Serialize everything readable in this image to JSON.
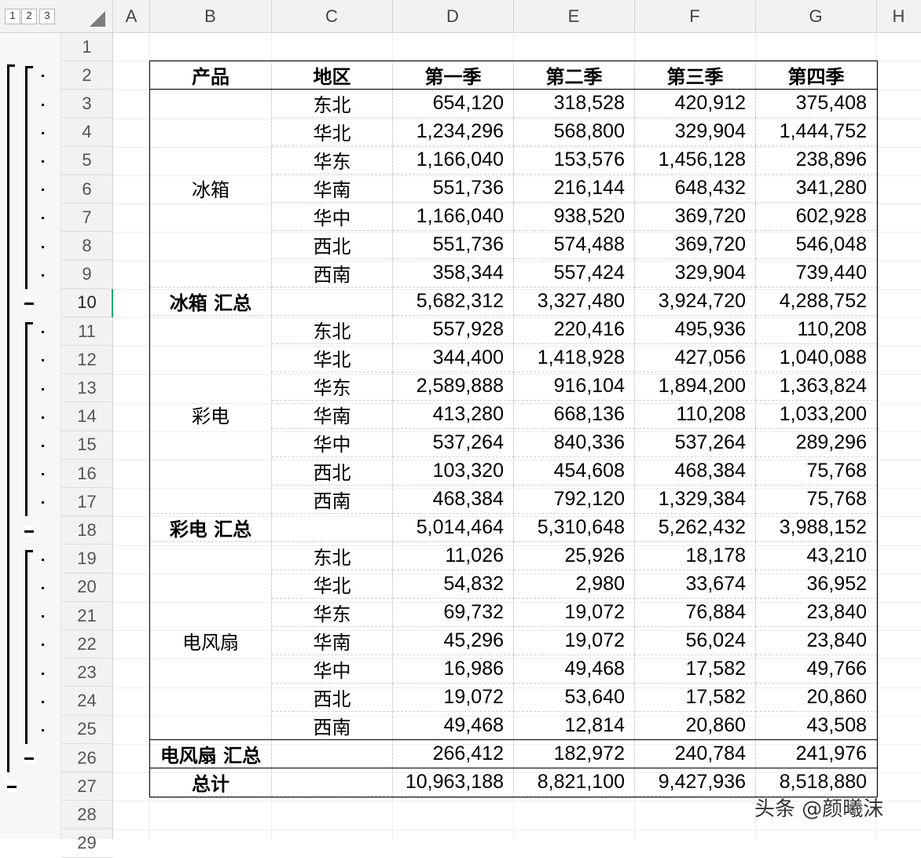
{
  "outline_levels": [
    "1",
    "2",
    "3"
  ],
  "columns": [
    "A",
    "B",
    "C",
    "D",
    "E",
    "F",
    "G",
    "H"
  ],
  "rows": [
    "1",
    "2",
    "3",
    "4",
    "5",
    "6",
    "7",
    "8",
    "9",
    "10",
    "11",
    "12",
    "13",
    "14",
    "15",
    "16",
    "17",
    "18",
    "19",
    "20",
    "21",
    "22",
    "23",
    "24",
    "25",
    "26",
    "27",
    "28",
    "29"
  ],
  "selected_row": "10",
  "table": {
    "headers": [
      "产品",
      "地区",
      "第一季",
      "第二季",
      "第三季",
      "第四季"
    ],
    "groups": [
      {
        "product": "冰箱",
        "subtotal_label": "冰箱 汇总",
        "rows": [
          {
            "region": "东北",
            "q": [
              "654,120",
              "318,528",
              "420,912",
              "375,408"
            ]
          },
          {
            "region": "华北",
            "q": [
              "1,234,296",
              "568,800",
              "329,904",
              "1,444,752"
            ]
          },
          {
            "region": "华东",
            "q": [
              "1,166,040",
              "153,576",
              "1,456,128",
              "238,896"
            ]
          },
          {
            "region": "华南",
            "q": [
              "551,736",
              "216,144",
              "648,432",
              "341,280"
            ]
          },
          {
            "region": "华中",
            "q": [
              "1,166,040",
              "938,520",
              "369,720",
              "602,928"
            ]
          },
          {
            "region": "西北",
            "q": [
              "551,736",
              "574,488",
              "369,720",
              "546,048"
            ]
          },
          {
            "region": "西南",
            "q": [
              "358,344",
              "557,424",
              "329,904",
              "739,440"
            ]
          }
        ],
        "subtotal": [
          "5,682,312",
          "3,327,480",
          "3,924,720",
          "4,288,752"
        ]
      },
      {
        "product": "彩电",
        "subtotal_label": "彩电 汇总",
        "rows": [
          {
            "region": "东北",
            "q": [
              "557,928",
              "220,416",
              "495,936",
              "110,208"
            ]
          },
          {
            "region": "华北",
            "q": [
              "344,400",
              "1,418,928",
              "427,056",
              "1,040,088"
            ]
          },
          {
            "region": "华东",
            "q": [
              "2,589,888",
              "916,104",
              "1,894,200",
              "1,363,824"
            ]
          },
          {
            "region": "华南",
            "q": [
              "413,280",
              "668,136",
              "110,208",
              "1,033,200"
            ]
          },
          {
            "region": "华中",
            "q": [
              "537,264",
              "840,336",
              "537,264",
              "289,296"
            ]
          },
          {
            "region": "西北",
            "q": [
              "103,320",
              "454,608",
              "468,384",
              "75,768"
            ]
          },
          {
            "region": "西南",
            "q": [
              "468,384",
              "792,120",
              "1,329,384",
              "75,768"
            ]
          }
        ],
        "subtotal": [
          "5,014,464",
          "5,310,648",
          "5,262,432",
          "3,988,152"
        ]
      },
      {
        "product": "电风扇",
        "subtotal_label": "电风扇 汇总",
        "rows": [
          {
            "region": "东北",
            "q": [
              "11,026",
              "25,926",
              "18,178",
              "43,210"
            ]
          },
          {
            "region": "华北",
            "q": [
              "54,832",
              "2,980",
              "33,674",
              "36,952"
            ]
          },
          {
            "region": "华东",
            "q": [
              "69,732",
              "19,072",
              "76,884",
              "23,840"
            ]
          },
          {
            "region": "华南",
            "q": [
              "45,296",
              "19,072",
              "56,024",
              "23,840"
            ]
          },
          {
            "region": "华中",
            "q": [
              "16,986",
              "49,468",
              "17,582",
              "49,766"
            ]
          },
          {
            "region": "西北",
            "q": [
              "19,072",
              "53,640",
              "17,582",
              "20,860"
            ]
          },
          {
            "region": "西南",
            "q": [
              "49,468",
              "12,814",
              "20,860",
              "43,508"
            ]
          }
        ],
        "subtotal": [
          "266,412",
          "182,972",
          "240,784",
          "241,976"
        ]
      }
    ],
    "total_label": "总计",
    "total": [
      "10,963,188",
      "8,821,100",
      "9,427,936",
      "8,518,880"
    ]
  },
  "watermark": "头条 @颜曦沫"
}
